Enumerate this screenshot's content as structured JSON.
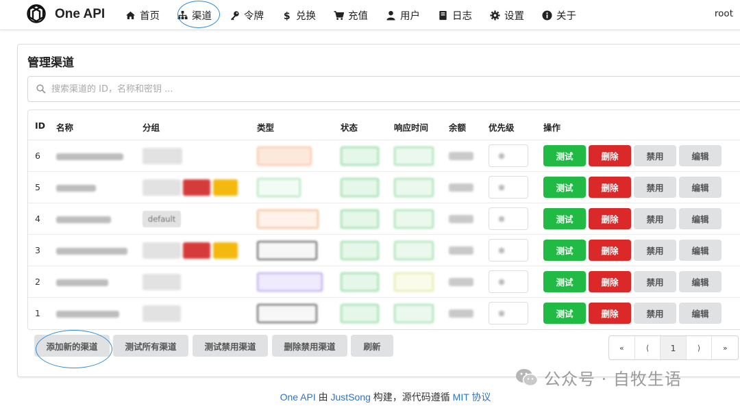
{
  "brand": {
    "name": "One API"
  },
  "nav": {
    "items": [
      {
        "label": "首页",
        "icon": "home-icon"
      },
      {
        "label": "渠道",
        "icon": "sitemap-icon"
      },
      {
        "label": "令牌",
        "icon": "key-icon"
      },
      {
        "label": "兑换",
        "icon": "dollar-icon"
      },
      {
        "label": "充值",
        "icon": "cart-icon"
      },
      {
        "label": "用户",
        "icon": "user-icon"
      },
      {
        "label": "日志",
        "icon": "book-icon"
      },
      {
        "label": "设置",
        "icon": "gear-icon"
      },
      {
        "label": "关于",
        "icon": "info-icon"
      }
    ],
    "user": "root"
  },
  "page": {
    "title": "管理渠道",
    "search_placeholder": "搜索渠道的 ID，名称和密钥 ..."
  },
  "table": {
    "headers": [
      "ID",
      "名称",
      "分组",
      "类型",
      "状态",
      "响应时间",
      "余额",
      "优先级",
      "操作"
    ],
    "rows": [
      {
        "id": "6"
      },
      {
        "id": "5"
      },
      {
        "id": "4",
        "group": "default"
      },
      {
        "id": "3"
      },
      {
        "id": "2"
      },
      {
        "id": "1"
      }
    ],
    "actions": {
      "test": "测试",
      "delete": "删除",
      "disable": "禁用",
      "edit": "编辑"
    }
  },
  "bottom": {
    "add": "添加新的渠道",
    "test_all": "测试所有渠道",
    "test_disabled": "测试禁用渠道",
    "delete_disabled": "删除禁用渠道",
    "refresh": "刷新"
  },
  "pager": {
    "first": "«",
    "prev": "⟨",
    "current": "1",
    "next": "⟩",
    "last": "»"
  },
  "footer": {
    "prefix": "One API",
    "by": " 由 ",
    "author": "JustSong",
    "middle": " 构建，源代码遵循 ",
    "license": "MIT 协议"
  },
  "watermark": {
    "text": "公众号 · 自牧生语"
  },
  "colors": {
    "green": "#21ba45",
    "red": "#db2828",
    "link": "#2e73c4",
    "grey": "#e0e1e2"
  }
}
